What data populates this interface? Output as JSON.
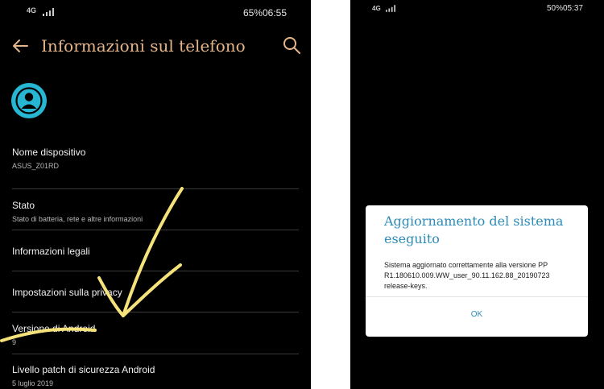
{
  "left_screen": {
    "status_bar": {
      "network": "4G",
      "battery": "65%",
      "time": "06:55"
    },
    "header": {
      "title": "Informazioni sul telefono",
      "back_icon": "arrow-left-icon",
      "search_icon": "search-icon"
    },
    "avatar_icon": "person-icon",
    "settings": [
      {
        "title": "Nome dispositivo",
        "subtitle": "ASUS_Z01RD"
      },
      {
        "title": "Stato",
        "subtitle": "Stato di batteria, rete e altre informazioni"
      },
      {
        "title": "Informazioni legali",
        "subtitle": ""
      },
      {
        "title": "Impostazioni sulla privacy",
        "subtitle": ""
      },
      {
        "title": "Versione di Android",
        "subtitle": "9"
      },
      {
        "title": "Livello patch di sicurezza Android",
        "subtitle": "5 luglio 2019"
      }
    ],
    "colors": {
      "accent": "#e5b58a",
      "avatar": "#27b7d3",
      "annotation": "#f6e27a"
    }
  },
  "right_screen": {
    "status_bar": {
      "network": "4G",
      "battery": "50%",
      "time": "05:37"
    },
    "dialog": {
      "title": "Aggiornamento del sistema eseguito",
      "message": "Sistema aggiornato correttamente alla versione PP R1.180610.009.WW_user_90.11.162.88_20190723 release-keys.",
      "ok_label": "OK"
    },
    "colors": {
      "accent": "#2c8cb8"
    }
  }
}
